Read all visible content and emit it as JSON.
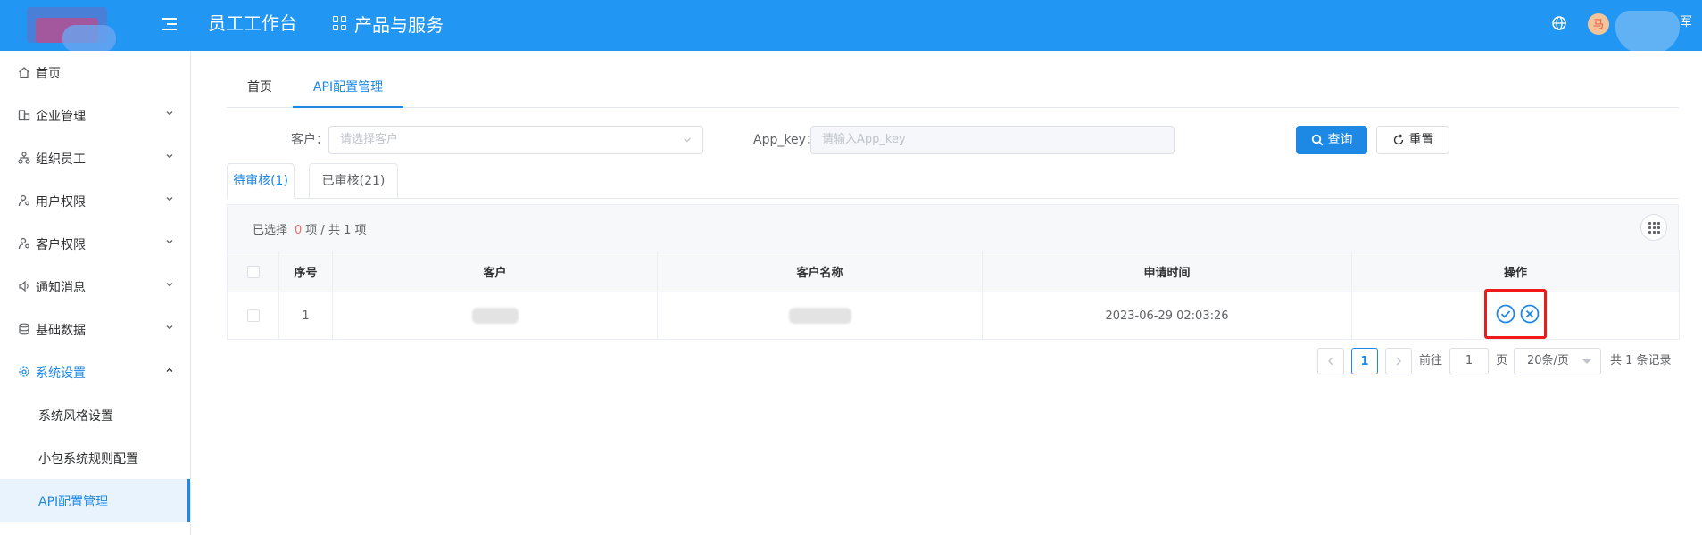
{
  "header": {
    "title": "员工工作台",
    "products_label": "产品与服务",
    "avatar_text": "马",
    "user_tail": "军"
  },
  "sidebar": {
    "items": [
      {
        "label": "首页",
        "icon": "home-icon",
        "expandable": false
      },
      {
        "label": "企业管理",
        "icon": "building-icon",
        "expandable": true
      },
      {
        "label": "组织员工",
        "icon": "org-icon",
        "expandable": true
      },
      {
        "label": "用户权限",
        "icon": "user-key-icon",
        "expandable": true
      },
      {
        "label": "客户权限",
        "icon": "customer-key-icon",
        "expandable": true
      },
      {
        "label": "通知消息",
        "icon": "speaker-icon",
        "expandable": true
      },
      {
        "label": "基础数据",
        "icon": "database-icon",
        "expandable": true
      },
      {
        "label": "系统设置",
        "icon": "gear-icon",
        "expandable": true,
        "expanded": true,
        "active": true
      }
    ],
    "sub_items": [
      {
        "label": "系统风格设置"
      },
      {
        "label": "小包系统规则配置"
      },
      {
        "label": "API配置管理",
        "active": true
      }
    ]
  },
  "nav_tabs": [
    {
      "label": "首页"
    },
    {
      "label": "API配置管理",
      "active": true
    }
  ],
  "filters": {
    "customer_label": "客户：",
    "customer_placeholder": "请选择客户",
    "appkey_label": "App_key：",
    "appkey_placeholder": "请输入App_key",
    "search_button": "查询",
    "reset_button": "重置"
  },
  "status_tabs": [
    {
      "label": "待审核(1)",
      "active": true
    },
    {
      "label": "已审核(21)"
    }
  ],
  "selection": {
    "prefix": "已选择",
    "count": "0",
    "suffix": "项 / 共 1 项"
  },
  "table": {
    "columns": [
      "序号",
      "客户",
      "客户名称",
      "申请时间",
      "操作"
    ],
    "rows": [
      {
        "index": "1",
        "customer": "",
        "customer_name": "",
        "apply_time": "2023-06-29 02:03:26"
      }
    ]
  },
  "pagination": {
    "current_page": "1",
    "goto_label": "前往",
    "goto_value": "1",
    "page_unit": "页",
    "page_size": "20条/页",
    "total_text": "共 1 条记录"
  },
  "colors": {
    "primary": "#1e88e5",
    "header_bg": "#2196f3",
    "highlight_box": "#f01a1a",
    "selected_count": "#f56c6c"
  }
}
